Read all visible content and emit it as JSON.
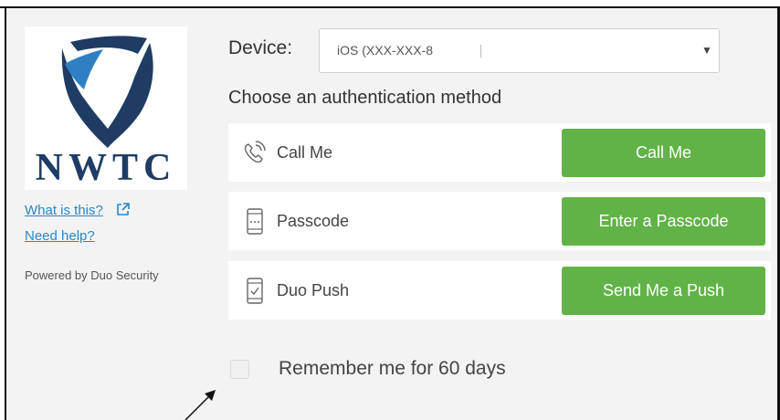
{
  "logo": {
    "text": "NWTC",
    "color_dark": "#1e3c64",
    "color_light": "#2f80c3"
  },
  "sidebar": {
    "what_is_this": "What is this?",
    "need_help": "Need help?",
    "powered_by": "Powered by Duo Security"
  },
  "device": {
    "label": "Device:",
    "value": "iOS (XXX-XXX-8"
  },
  "choose_label": "Choose an authentication method",
  "methods": [
    {
      "icon": "phone-call-icon",
      "label": "Call Me",
      "button": "Call Me"
    },
    {
      "icon": "passcode-device-icon",
      "label": "Passcode",
      "button": "Enter a Passcode"
    },
    {
      "icon": "push-device-icon",
      "label": "Duo Push",
      "button": "Send Me a Push"
    }
  ],
  "remember": {
    "label": "Remember me for 60 days",
    "checked": false
  },
  "colors": {
    "button_green": "#61b347",
    "link_blue": "#2a87c5",
    "background": "#f3f3f3"
  }
}
